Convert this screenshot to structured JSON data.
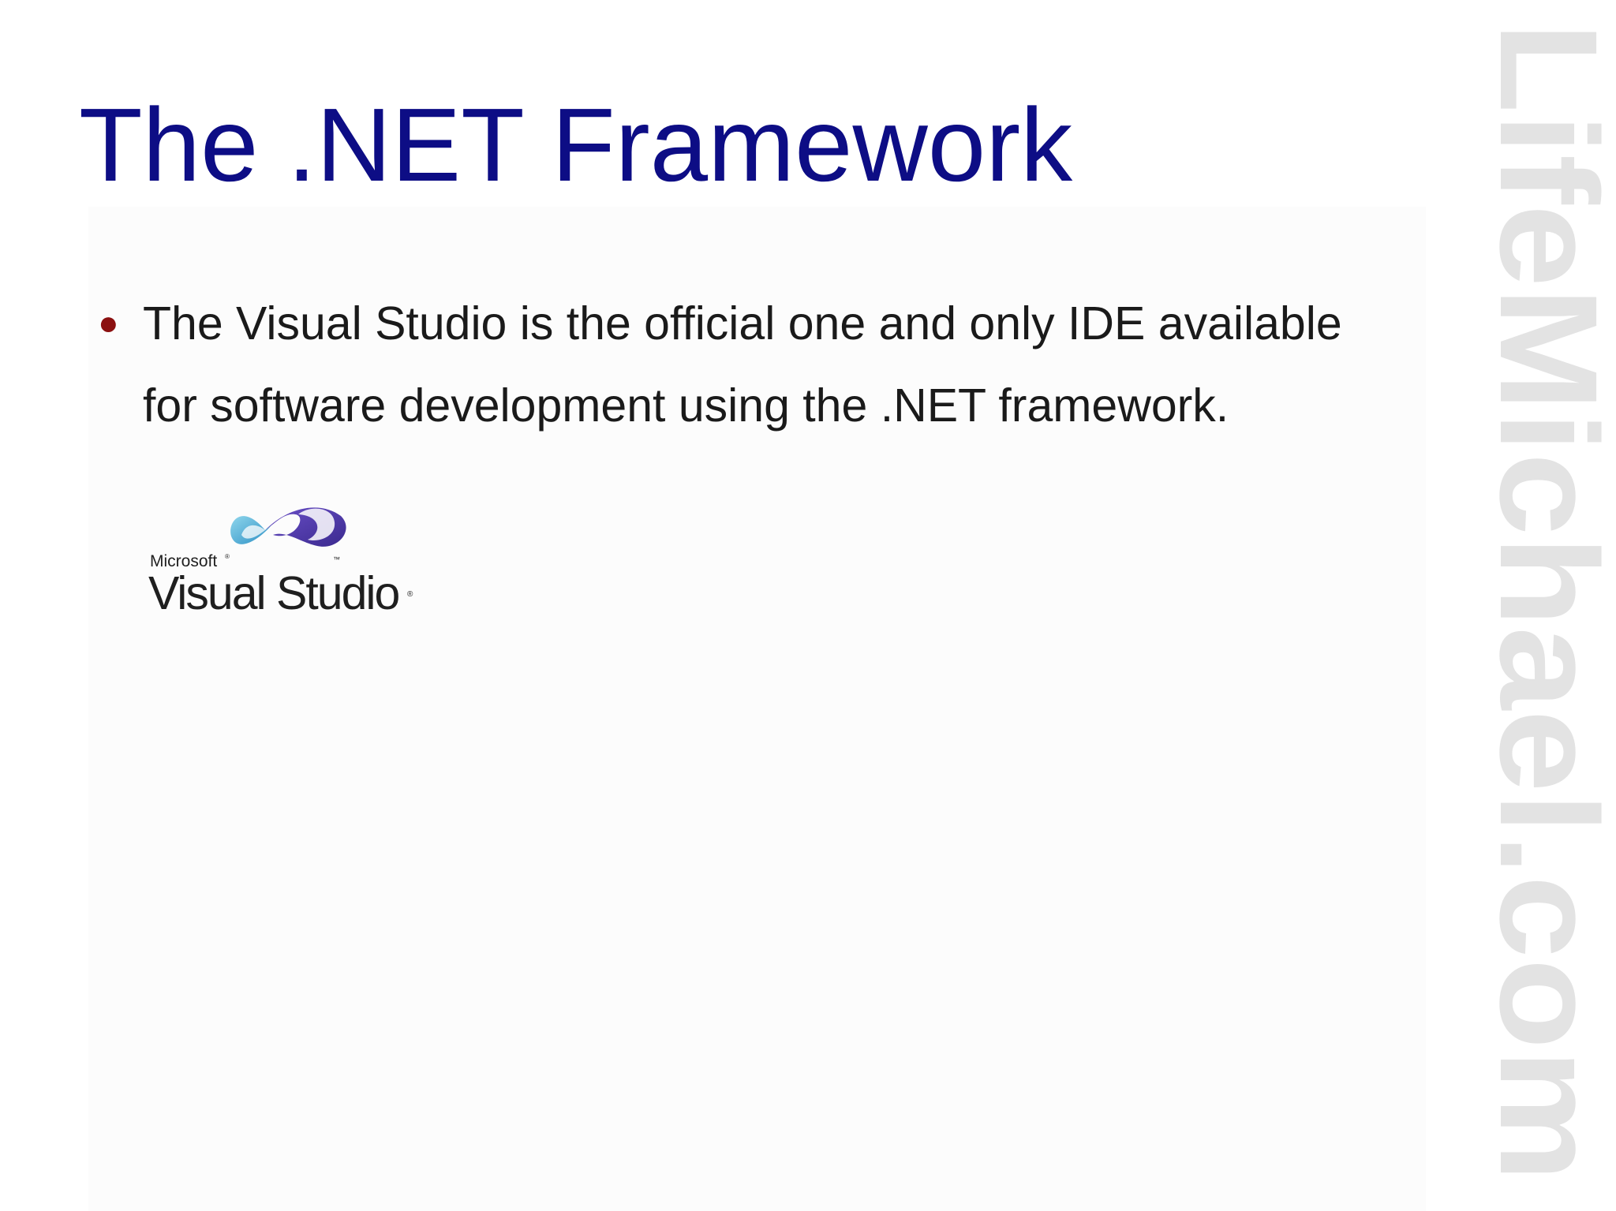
{
  "slide": {
    "title": "The .NET Framework",
    "bullets": [
      {
        "line1": "The Visual Studio is the official one and only IDE available",
        "line2": "for software development using the .NET framework."
      }
    ]
  },
  "logo": {
    "brand": "Microsoft",
    "product": "Visual Studio",
    "trademark": "™",
    "registered": "®"
  },
  "watermark": {
    "text": "LifeMichael.com"
  },
  "colors": {
    "title": "#0d0d85",
    "body_text": "#1a1a1a",
    "bullet": "#8b1010",
    "watermark": "#e3e3e3",
    "logo_text": "#1f1f1f"
  }
}
